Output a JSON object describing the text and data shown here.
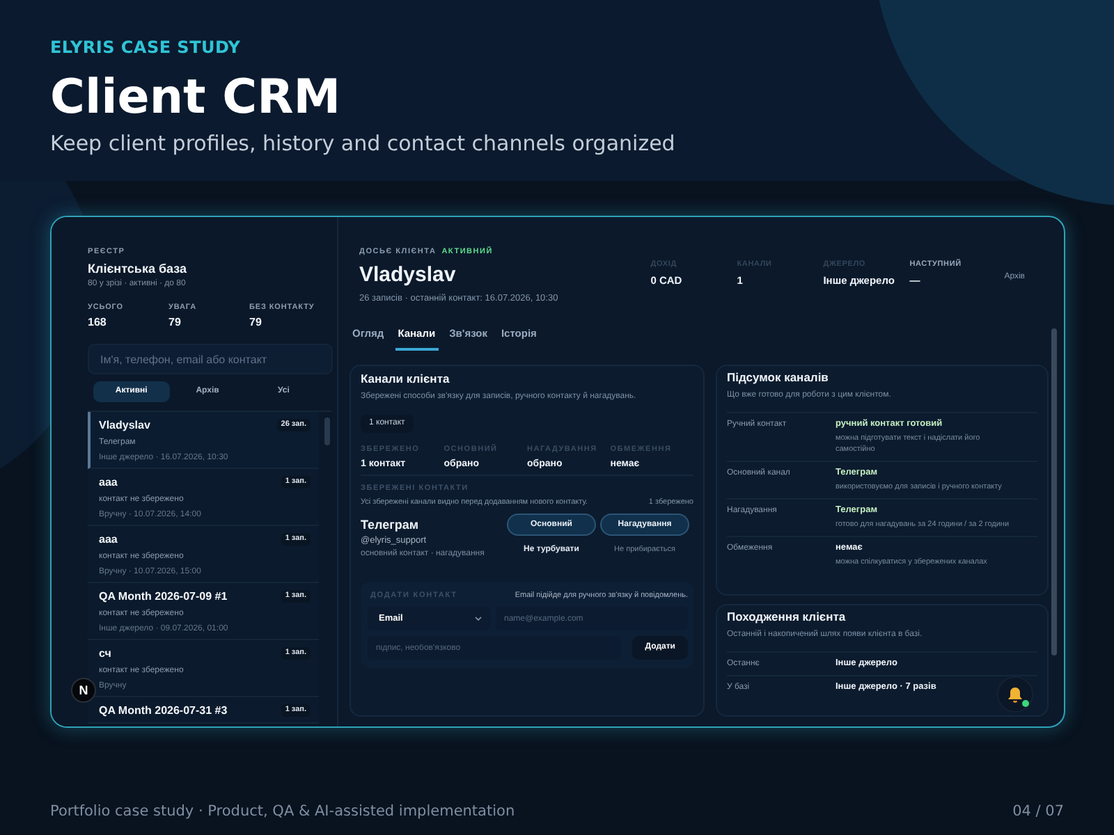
{
  "hero": {
    "eyebrow": "ELYRIS CASE STUDY",
    "title": "Client CRM",
    "subtitle": "Keep client profiles, history and contact channels organized"
  },
  "sidebar": {
    "overline": "РЕЄСТР",
    "title": "Клієнтська база",
    "summary": "80 у зрізі · активні · до 80",
    "stats": [
      {
        "label": "УСЬОГО",
        "value": "168"
      },
      {
        "label": "УВАГА",
        "value": "79"
      },
      {
        "label": "БЕЗ КОНТАКТУ",
        "value": "79"
      }
    ],
    "search": {
      "placeholder": "Ім'я, телефон, email або контакт"
    },
    "filters": [
      {
        "label": "Активні",
        "selected": true
      },
      {
        "label": "Архів",
        "selected": false
      },
      {
        "label": "Усі",
        "selected": false
      }
    ],
    "clients": [
      {
        "name": "Vladyslav",
        "count": "26 зап.",
        "channel": "Телеграм",
        "meta": "Інше джерело · 16.07.2026, 10:30",
        "selected": true
      },
      {
        "name": "aaa",
        "count": "1 зап.",
        "channel": "контакт не збережено",
        "meta": "Вручну · 10.07.2026, 14:00",
        "selected": false
      },
      {
        "name": "aaa",
        "count": "1 зап.",
        "channel": "контакт не збережено",
        "meta": "Вручну · 10.07.2026, 15:00",
        "selected": false
      },
      {
        "name": "QA Month 2026-07-09 #1",
        "count": "1 зап.",
        "channel": "контакт не збережено",
        "meta": "Інше джерело · 09.07.2026, 01:00",
        "selected": false
      },
      {
        "name": "сч",
        "count": "1 зап.",
        "channel": "контакт не збережено",
        "meta": "Вручну",
        "selected": false
      },
      {
        "name": "QA Month 2026-07-31 #3",
        "count": "1 зап.",
        "selected": false
      }
    ]
  },
  "dossier": {
    "overline": "ДОСЬЄ КЛІЄНТА",
    "status": "АКТИВНИЙ",
    "name": "Vladyslav",
    "summary": "26 записів · останній контакт: 16.07.2026, 10:30",
    "stats": [
      {
        "label": "ДОХІД",
        "value": "0 CAD",
        "emphasized": false
      },
      {
        "label": "КАНАЛИ",
        "value": "1",
        "emphasized": false
      },
      {
        "label": "ДЖЕРЕЛО",
        "value": "Інше джерело",
        "emphasized": false
      },
      {
        "label": "НАСТУПНИЙ",
        "value": "—",
        "emphasized": true
      }
    ],
    "archive_button": "Архів"
  },
  "tabs": [
    {
      "label": "Огляд",
      "selected": false
    },
    {
      "label": "Канали",
      "selected": true
    },
    {
      "label": "Зв'язок",
      "selected": false
    },
    {
      "label": "Історія",
      "selected": false
    }
  ],
  "channels_panel": {
    "title": "Канали клієнта",
    "description": "Збережені способи зв'язку для записів, ручного контакту й нагадувань.",
    "chip": "1 контакт",
    "stats": [
      {
        "label": "ЗБЕРЕЖЕНО",
        "value": "1 контакт"
      },
      {
        "label": "ОСНОВНИЙ",
        "value": "обрано"
      },
      {
        "label": "НАГАДУВАННЯ",
        "value": "обрано"
      },
      {
        "label": "ОБМЕЖЕННЯ",
        "value": "немає"
      }
    ],
    "saved_heading": "ЗБЕРЕЖЕНІ КОНТАКТИ",
    "saved_description": "Усі збережені канали видно перед додаванням нового контакту.",
    "saved_count": "1 збережено",
    "contacts": [
      {
        "channel": "Телеграм",
        "handle": "@elyris_support",
        "roles": "основний контакт · нагадування",
        "actions": [
          {
            "label": "Основний",
            "kind": "pill"
          },
          {
            "label": "Нагадування",
            "kind": "pill"
          },
          {
            "label": "Не турбувати",
            "kind": "text"
          },
          {
            "label": "Не прибирається",
            "kind": "muted"
          }
        ]
      }
    ],
    "add_contact": {
      "heading": "ДОДАТИ КОНТАКТ",
      "hint": "Email підійде для ручного зв'язку й повідомлень.",
      "type": "Email",
      "address": {
        "placeholder": "name@example.com"
      },
      "label": {
        "placeholder": "підпис, необов'язково"
      },
      "button": "Додати"
    }
  },
  "summary_panel": {
    "title": "Підсумок каналів",
    "description": "Що вже готово для роботи з цим клієнтом.",
    "rows": [
      {
        "label": "Ручний контакт",
        "value": "ручний контакт готовий",
        "note": "можна підготувати текст і надіслати його самостійно",
        "positive": true
      },
      {
        "label": "Основний канал",
        "value": "Телеграм",
        "note": "використовуємо для записів і ручного контакту",
        "positive": true
      },
      {
        "label": "Нагадування",
        "value": "Телеграм",
        "note": "готово для нагадувань за 24 години / за 2 години",
        "positive": true
      },
      {
        "label": "Обмеження",
        "value": "немає",
        "note": "можна спілкуватися у збережених каналах",
        "positive": false
      }
    ]
  },
  "origin_panel": {
    "title": "Походження клієнта",
    "description": "Останній і накопичений шлях появи клієнта в базі.",
    "rows": [
      {
        "label": "Останнє",
        "value": "Інше джерело"
      },
      {
        "label": "У базі",
        "value": "Інше джерело · 7 разів"
      }
    ]
  },
  "dev_badge": "N",
  "footer": {
    "caption": "Portfolio case study · Product, QA & AI-assisted implementation",
    "page": "04 / 07"
  }
}
